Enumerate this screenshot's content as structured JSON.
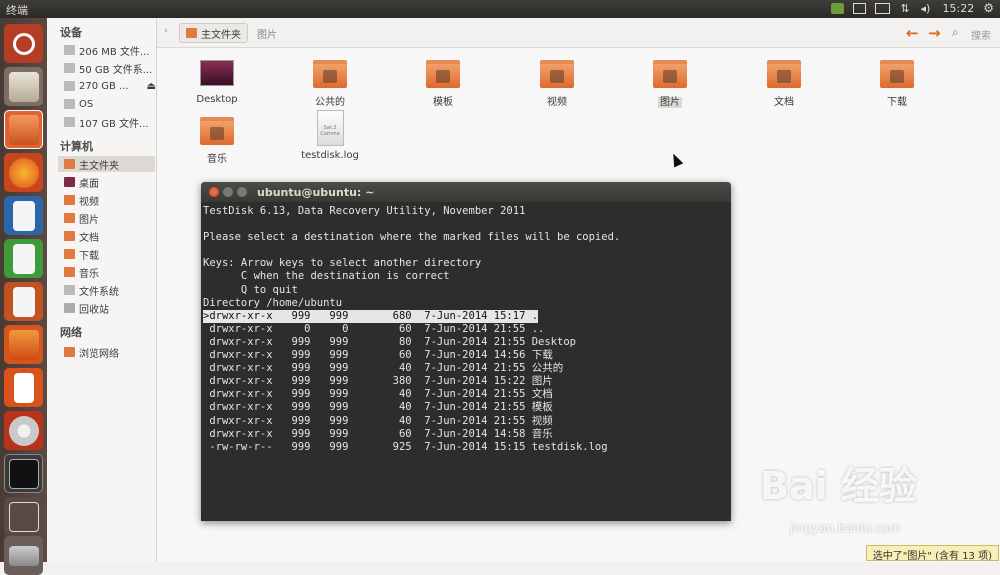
{
  "window": {
    "title": "终端",
    "time": "15:22"
  },
  "sidebar": {
    "devices_header": "设备",
    "devices": [
      "206 MB 文件...",
      "50 GB 文件系...",
      "270 GB ...",
      "OS",
      "107 GB 文件..."
    ],
    "computer_header": "计算机",
    "computer": [
      "主文件夹",
      "桌面",
      "视频",
      "图片",
      "文档",
      "下载",
      "音乐",
      "文件系统",
      "回收站"
    ],
    "network_header": "网络",
    "network": [
      "浏览网络"
    ]
  },
  "toolbar": {
    "crumb_home": "主文件夹",
    "crumb_pictures": "图片",
    "search_label": "搜索"
  },
  "files": [
    "Desktop",
    "公共的",
    "模板",
    "视频",
    "图片",
    "文档",
    "下载",
    "音乐",
    "testdisk.log"
  ],
  "testdisk_thumb": "Sat.2 Comma",
  "terminal": {
    "title": "ubuntu@ubuntu: ~",
    "lines": [
      "TestDisk 6.13, Data Recovery Utility, November 2011",
      "",
      "Please select a destination where the marked files will be copied.",
      "",
      "Keys: Arrow keys to select another directory",
      "      C when the destination is correct",
      "      Q to quit",
      "Directory /home/ubuntu",
      ">drwxr-xr-x   999   999       680  7-Jun-2014 15:17 .",
      " drwxr-xr-x     0     0        60  7-Jun-2014 21:55 ..",
      " drwxr-xr-x   999   999        80  7-Jun-2014 21:55 Desktop",
      " drwxr-xr-x   999   999        60  7-Jun-2014 14:56 下载",
      " drwxr-xr-x   999   999        40  7-Jun-2014 21:55 公共的",
      " drwxr-xr-x   999   999       380  7-Jun-2014 15:22 图片",
      " drwxr-xr-x   999   999        40  7-Jun-2014 21:55 文档",
      " drwxr-xr-x   999   999        40  7-Jun-2014 21:55 模板",
      " drwxr-xr-x   999   999        40  7-Jun-2014 21:55 视频",
      " drwxr-xr-x   999   999        60  7-Jun-2014 14:58 音乐",
      " -rw-rw-r--   999   999       925  7-Jun-2014 15:15 testdisk.log"
    ]
  },
  "status_text": "选中了\"图片\" (含有 13 项)",
  "watermark": {
    "brand": "Bai 经验",
    "url": "jingyan.baidu.com"
  },
  "colors": {
    "accent": "#dd4814",
    "folder": "#e58a52",
    "terminal_bg": "#2d2d2d",
    "panel": "#3c3b37"
  }
}
